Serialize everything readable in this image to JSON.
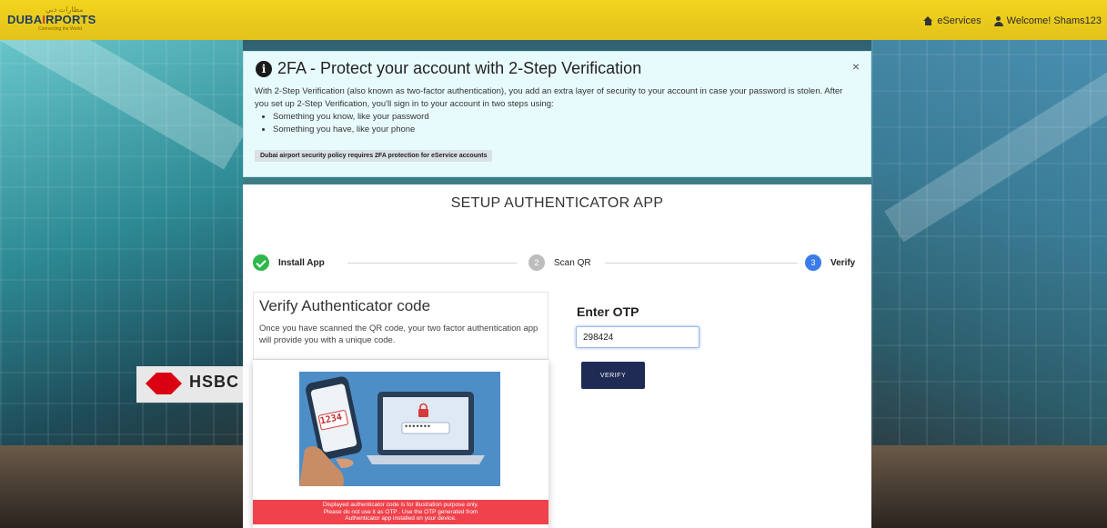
{
  "header": {
    "logo_arabic": "مطارات دبي",
    "logo_prefix": "DUBA",
    "logo_accent": "I",
    "logo_suffix": "RPORTS",
    "logo_tagline": "Connecting the World",
    "nav": [
      {
        "label": "eServices",
        "icon": "home-icon"
      },
      {
        "label": "Welcome! Shams123",
        "icon": "user-icon"
      }
    ]
  },
  "alert": {
    "title": "2FA - Protect your account with 2-Step Verification",
    "close_label": "×",
    "body": "With 2-Step Verification (also known as two-factor authentication), you add an extra layer of security to your account in case your password is stolen. After you set up 2-Step Verification, you'll sign in to your account in two steps using:",
    "bullets": [
      "Something you know, like your password",
      "Something you have, like your phone"
    ],
    "policy_badge": "Dubai airport security policy requires 2FA protection for eService accounts"
  },
  "setup": {
    "title": "SETUP AUTHENTICATOR APP",
    "steps": [
      {
        "number": "",
        "label": "Install App",
        "state": "done"
      },
      {
        "number": "2",
        "label": "Scan QR",
        "state": "pending"
      },
      {
        "number": "3",
        "label": "Verify",
        "state": "active"
      }
    ],
    "verify_title": "Verify Authenticator code",
    "verify_desc": "Once you have scanned the QR code, your two factor authentication app will provide you with a unique code.",
    "illustration": {
      "phone_code": "1234",
      "laptop_password": "•••••••",
      "warning_lines": [
        "Displayed authenticator code is for illustration purpose only.",
        "Please do not use it as OTP . Use the OTP generated from",
        "Authenticator app installed on your device."
      ]
    },
    "otp_label": "Enter OTP",
    "otp_value": "298424",
    "verify_button": "VERIFY"
  },
  "background": {
    "sign_text": "HSBC"
  },
  "colors": {
    "header_yellow": "#f2d41e",
    "alert_bg": "#e8fbfc",
    "step_done": "#2eb84b",
    "step_pending": "#bdbdbd",
    "step_active": "#3b7bea",
    "verify_button": "#1f2a55",
    "warning_red": "#f0424c"
  }
}
